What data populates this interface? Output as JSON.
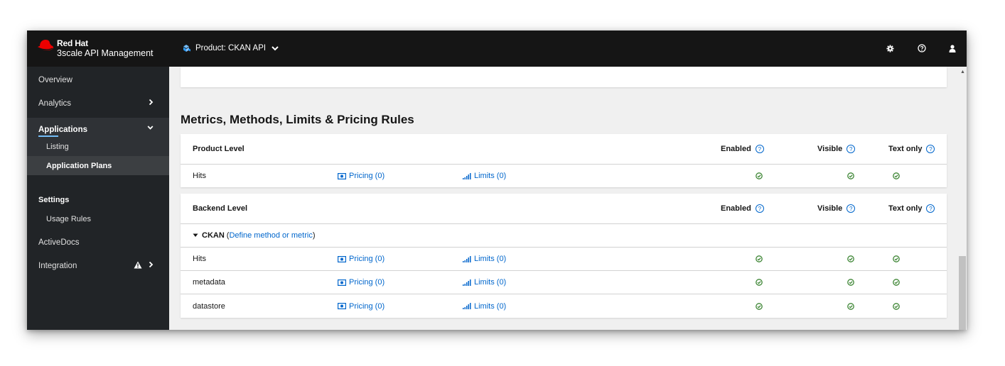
{
  "brand": {
    "line1": "Red Hat",
    "line2": "3scale API Management",
    "logo_icon": "red-hat-logo"
  },
  "context": {
    "label": "Product: CKAN API",
    "icon": "product-icon",
    "chevron": "chevron-down-icon"
  },
  "tools": [
    {
      "name": "settings",
      "glyph": "⚙"
    },
    {
      "name": "help",
      "glyph": "?"
    },
    {
      "name": "user",
      "glyph": "user"
    }
  ],
  "sidebar": {
    "overview": "Overview",
    "analytics": "Analytics",
    "applications": "Applications",
    "listing": "Listing",
    "application_plans": "Application Plans",
    "settings_header": "Settings",
    "usage_rules": "Usage Rules",
    "activedocs": "ActiveDocs",
    "integration": "Integration"
  },
  "main": {
    "section_title": "Metrics, Methods, Limits & Pricing Rules",
    "product": {
      "header": "Product Level",
      "col_enabled": "Enabled",
      "col_visible": "Visible",
      "col_text_only": "Text only",
      "rows": [
        {
          "name": "Hits",
          "pricing": "Pricing (0)",
          "limits": "Limits (0)"
        }
      ]
    },
    "backend": {
      "header": "Backend Level",
      "col_enabled": "Enabled",
      "col_visible": "Visible",
      "col_text_only": "Text only",
      "group_name": "CKAN",
      "group_link": "Define method or metric",
      "rows": [
        {
          "name": "Hits",
          "pricing": "Pricing (0)",
          "limits": "Limits (0)"
        },
        {
          "name": "metadata",
          "pricing": "Pricing (0)",
          "limits": "Limits (0)"
        },
        {
          "name": "datastore",
          "pricing": "Pricing (0)",
          "limits": "Limits (0)"
        }
      ]
    }
  },
  "colors": {
    "masthead": "#151515",
    "sidebar": "#212427",
    "link": "#0066cc",
    "check": "#3e8635",
    "brand_red": "#ee0000"
  }
}
